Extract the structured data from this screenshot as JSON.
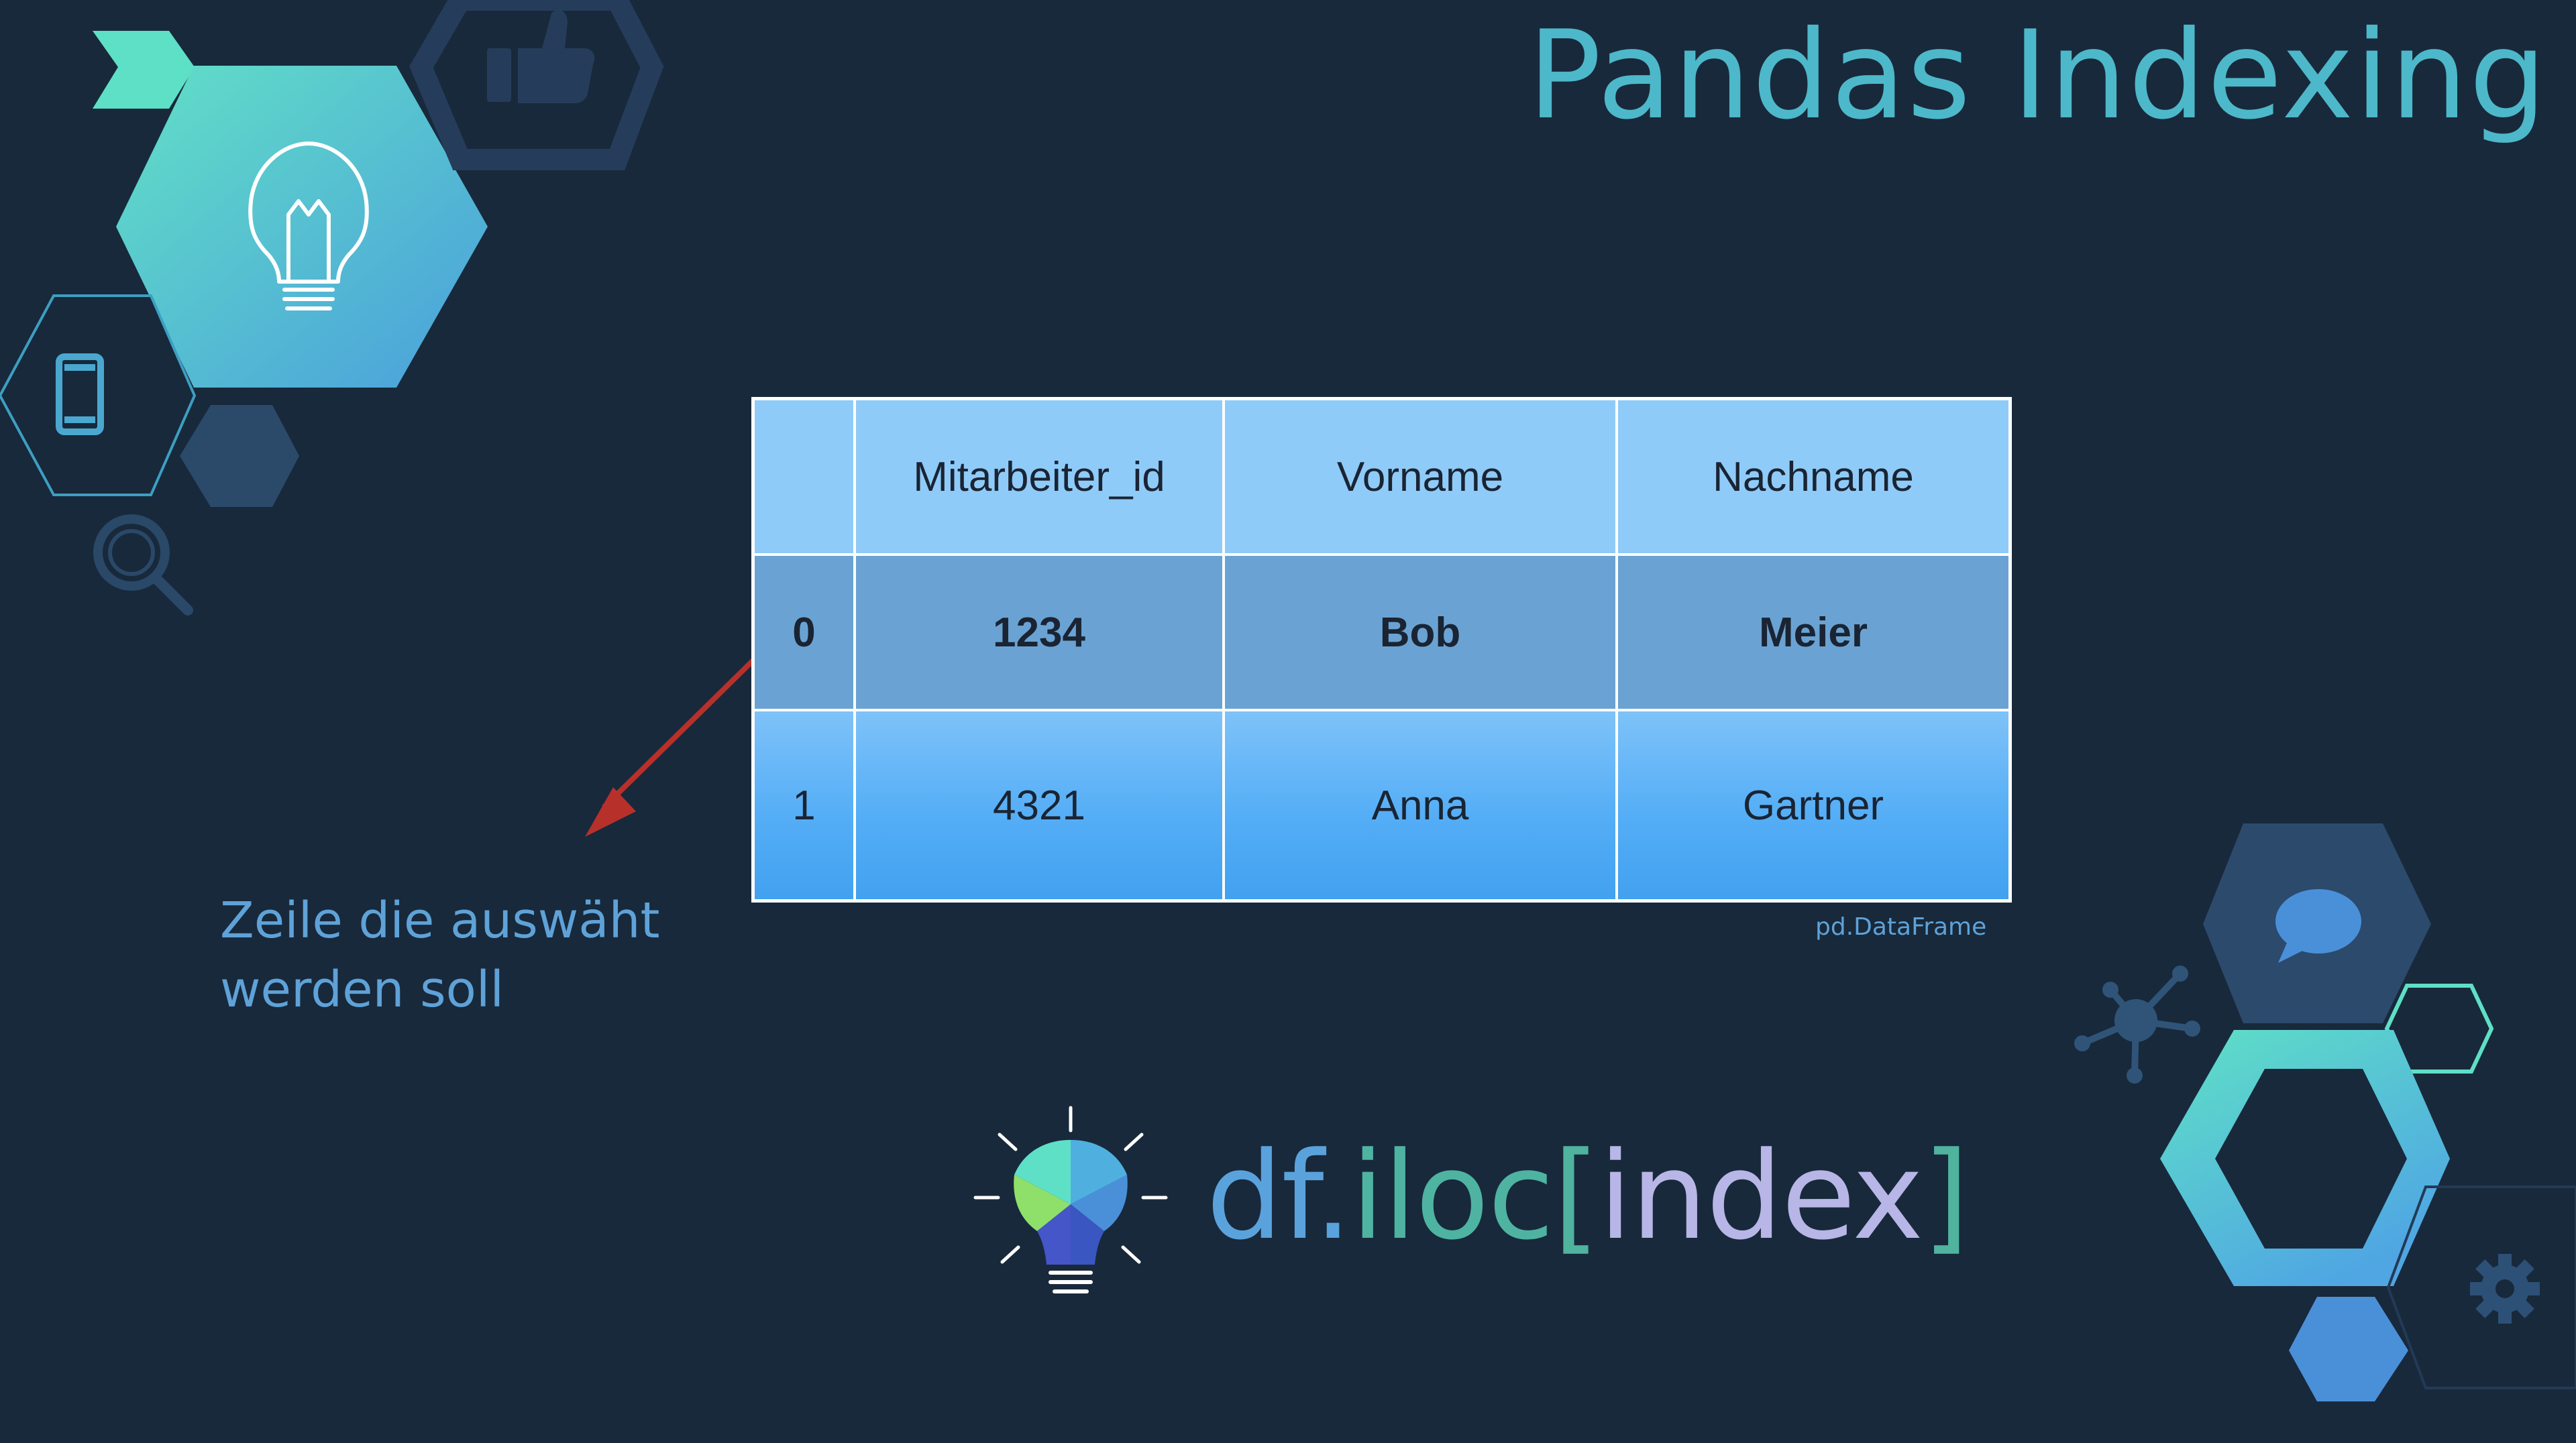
{
  "title": "Pandas Indexing",
  "table": {
    "headers": [
      "",
      "Mitarbeiter_id",
      "Vorname",
      "Nachname"
    ],
    "rows": [
      [
        "0",
        "1234",
        "Bob",
        "Meier"
      ],
      [
        "1",
        "4321",
        "Anna",
        "Gartner"
      ]
    ],
    "selected_row_index": 0,
    "caption": "pd.DataFrame"
  },
  "annotation": {
    "line1": "Zeile die auswäht",
    "line2": "werden soll",
    "arrow_color": "#b8302a"
  },
  "code": {
    "part1": "df.",
    "part2": "iloc",
    "part3": "[",
    "part4": "index",
    "part5": "]",
    "colors": {
      "part1": "#5aa2dc",
      "part2": "#4fb3a2",
      "part3": "#4fb39e",
      "part4": "#b7b6e6",
      "part5": "#4fb39e"
    }
  },
  "icons": [
    "thumbs-up-icon",
    "light-bulb-icon",
    "smartphone-icon",
    "magnifier-icon",
    "chat-bubble-icon",
    "network-icon",
    "gear-icon",
    "idea-bulb-icon"
  ],
  "colors": {
    "background": "#18293b",
    "title": "#4db8c9",
    "teal": "#5ddbc5",
    "blue": "#4a90d9"
  }
}
